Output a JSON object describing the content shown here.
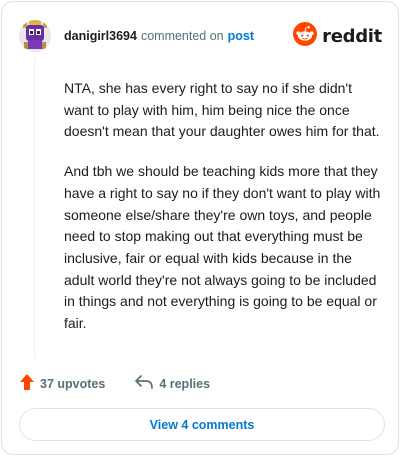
{
  "header": {
    "username": "danigirl3694",
    "action": "commented on",
    "post_link": "post",
    "brand": "reddit"
  },
  "comment": {
    "paragraphs": [
      "NTA, she has every right to say no if she didn't want to play with him, him being nice the once doesn't mean that your daughter owes him for that.",
      "And tbh we should be teaching kids more that they have a right to say no if they don't want to play with someone else/share they're own toys, and people need to stop making out that everything must be inclusive, fair or equal with kids because in the adult world they're not always going to be included in things and not everything is going to be equal or fair."
    ]
  },
  "actions": {
    "upvotes": "37 upvotes",
    "replies": "4 replies"
  },
  "footer": {
    "view_comments": "View 4 comments"
  },
  "colors": {
    "brand_orange": "#ff4500",
    "link_blue": "#0079d3",
    "meta_gray": "#576f76"
  },
  "icons": {
    "upvote": "upvote-arrow-icon",
    "reply": "reply-arrow-icon",
    "logo": "reddit-snoo-icon"
  }
}
